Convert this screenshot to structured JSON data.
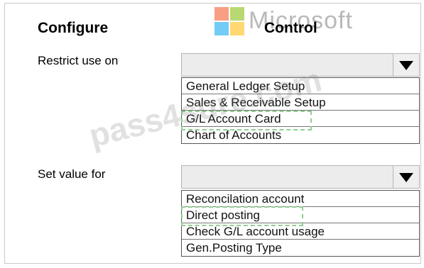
{
  "branding": {
    "logo_text": "Microsoft",
    "logo_colors": [
      "#f25022",
      "#7fba00",
      "#00a4ef",
      "#ffb900"
    ]
  },
  "header": {
    "configure_label": "Configure",
    "control_label": "Control"
  },
  "restrict": {
    "label": "Restrict use on",
    "selected_value": "",
    "options": [
      "General Ledger Setup",
      "Sales & Receivable Setup",
      "G/L Account Card",
      "Chart of Accounts"
    ]
  },
  "setvalue": {
    "label": "Set value for",
    "selected_value": "",
    "options": [
      "Reconcilation account",
      "Direct posting",
      "Check G/L account usage",
      "Gen.Posting Type"
    ]
  },
  "watermark": "pass4sure.com"
}
